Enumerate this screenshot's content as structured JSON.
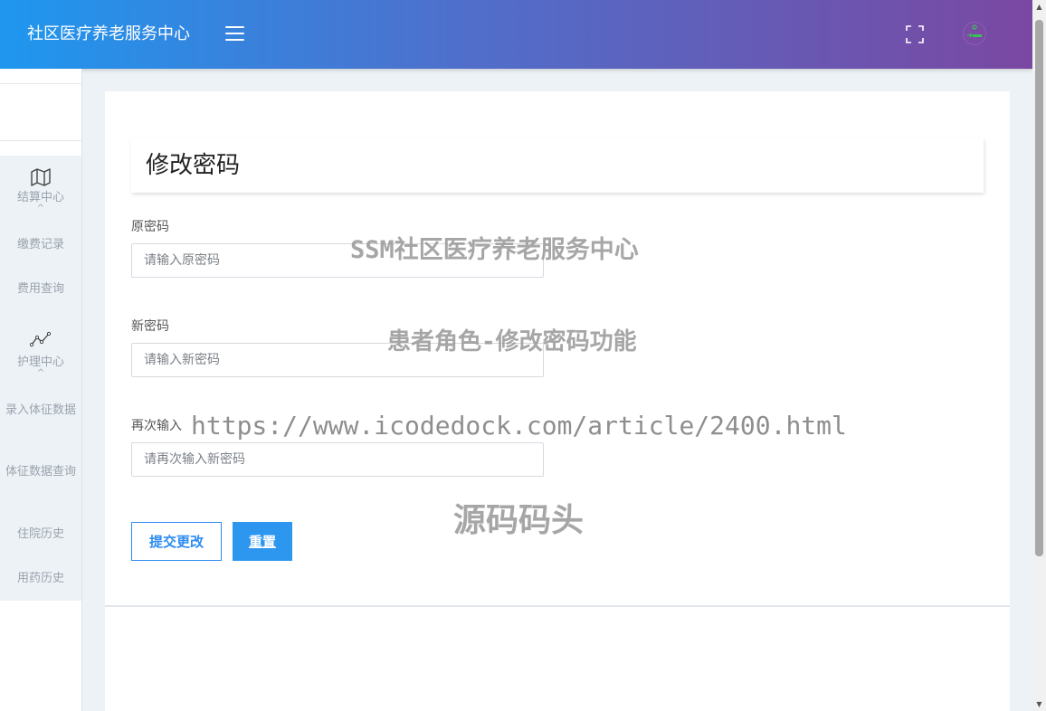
{
  "header": {
    "brand": "社区医疗养老服务中心",
    "menu_icon": "hamburger-menu-icon",
    "fullscreen_icon": "fullscreen-icon",
    "avatar_icon": "user-avatar-icon"
  },
  "sidebar": {
    "groups": [
      {
        "icon": "map-icon",
        "label": "结算中心",
        "items": [
          "缴费记录",
          "费用查询"
        ]
      },
      {
        "icon": "trend-line-icon",
        "label": "护理中心",
        "items": [
          "录入体征数据",
          "体征数据查询",
          "住院历史",
          "用药历史"
        ]
      }
    ]
  },
  "form": {
    "title": "修改密码",
    "fields": [
      {
        "label": "原密码",
        "placeholder": "请输入原密码"
      },
      {
        "label": "新密码",
        "placeholder": "请输入新密码"
      },
      {
        "label": "再次输入",
        "placeholder": "请再次输入新密码"
      }
    ],
    "submit_label": "提交更改",
    "reset_label": "重置"
  },
  "watermarks": [
    "SSM社区医疗养老服务中心",
    "患者角色-修改密码功能",
    "https://www.icodedock.com/article/2400.html",
    "源码码头"
  ],
  "colors": {
    "header_gradient_start": "#1f97ef",
    "header_gradient_end": "#7a48a2",
    "primary": "#2d8cf0",
    "background": "#edf2f6"
  }
}
